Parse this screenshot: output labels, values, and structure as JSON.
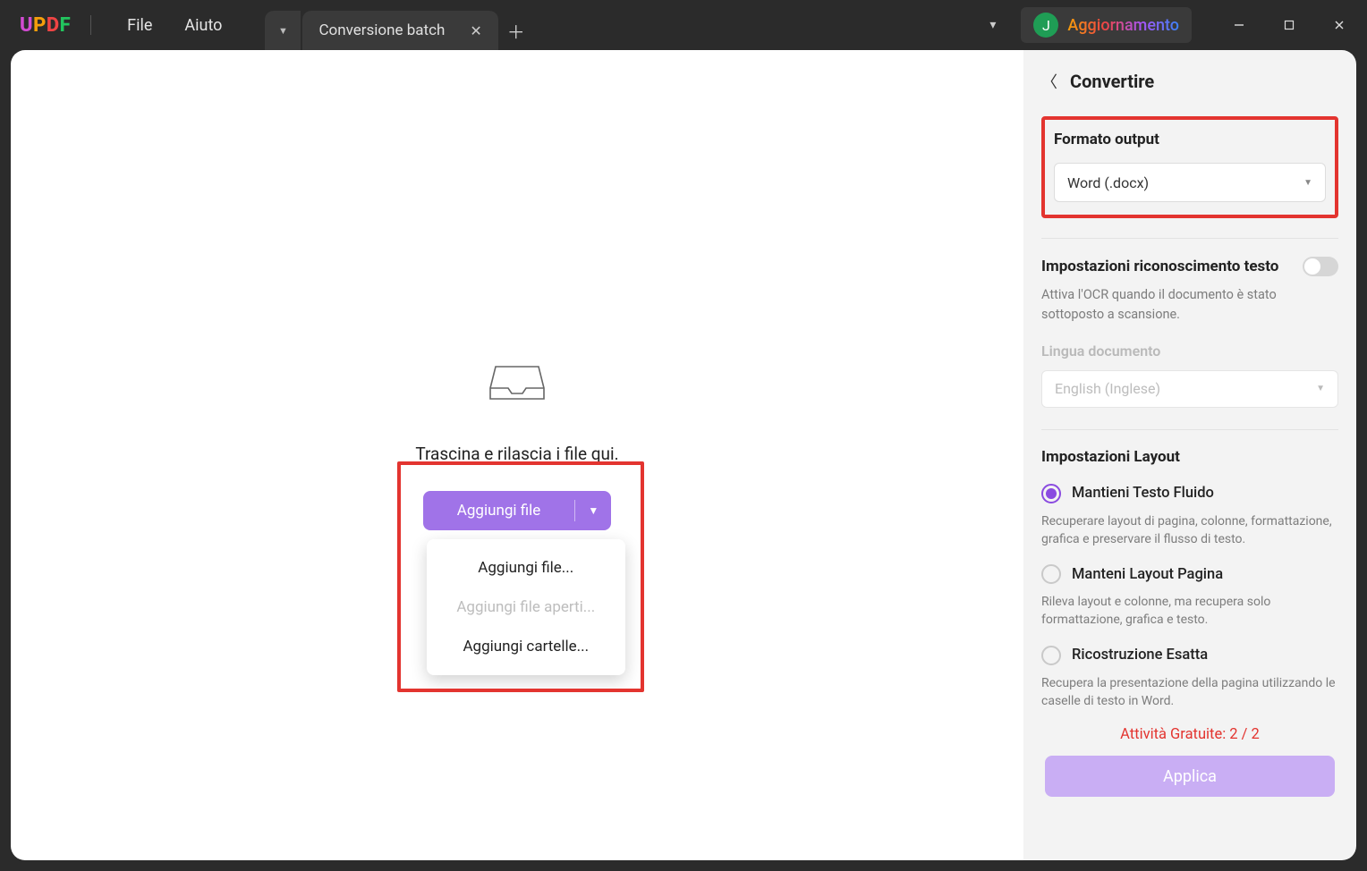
{
  "titlebar": {
    "menu_file": "File",
    "menu_help": "Aiuto",
    "tab_title": "Conversione batch",
    "update_label": "Aggiornamento",
    "avatar_letter": "J"
  },
  "main": {
    "drop_hint": "Trascina e rilascia i file qui.",
    "add_file_label": "Aggiungi file",
    "dropdown": {
      "add_files": "Aggiungi file...",
      "add_open_files": "Aggiungi file aperti...",
      "add_folders": "Aggiungi cartelle..."
    }
  },
  "side": {
    "title": "Convertire",
    "output_format_label": "Formato output",
    "output_format_value": "Word (.docx)",
    "ocr_title": "Impostazioni riconoscimento testo",
    "ocr_desc": "Attiva l'OCR quando il documento è stato sottoposto a scansione.",
    "lang_label": "Lingua documento",
    "lang_value": "English (Inglese)",
    "layout_title": "Impostazioni Layout",
    "layout_options": {
      "fluid_label": "Mantieni Testo Fluido",
      "fluid_desc": "Recuperare layout di pagina, colonne, formattazione, grafica e preservare il flusso di testo.",
      "page_label": "Manteni Layout Pagina",
      "page_desc": "Rileva layout e colonne, ma recupera solo formattazione, grafica e testo.",
      "exact_label": "Ricostruzione Esatta",
      "exact_desc": "Recupera la presentazione della pagina utilizzando le caselle di testo in Word."
    },
    "free_activity": "Attività Gratuite: 2 / 2",
    "apply_label": "Applica"
  }
}
